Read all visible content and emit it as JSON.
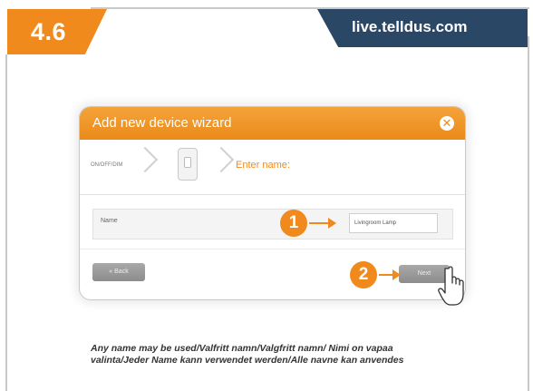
{
  "header": {
    "step_number": "4.6",
    "site_url": "live.telldus.com"
  },
  "wizard": {
    "title": "Add new device wizard",
    "step_first_label": "ON/OFF/DIM",
    "step_current_label": "Enter name:",
    "name_field_label": "Name",
    "name_field_value": "Livingroom Lamp",
    "back_label": "« Back",
    "next_label": "Next"
  },
  "callouts": {
    "first": "1",
    "second": "2"
  },
  "caption": "Any name may be used/Valfritt namn/Valgfritt namn/ Nimi on vapaa valinta/Jeder Name kann verwendet werden/Alle navne kan anvendes",
  "colors": {
    "accent": "#f08a1c",
    "banner": "#2b4766"
  }
}
